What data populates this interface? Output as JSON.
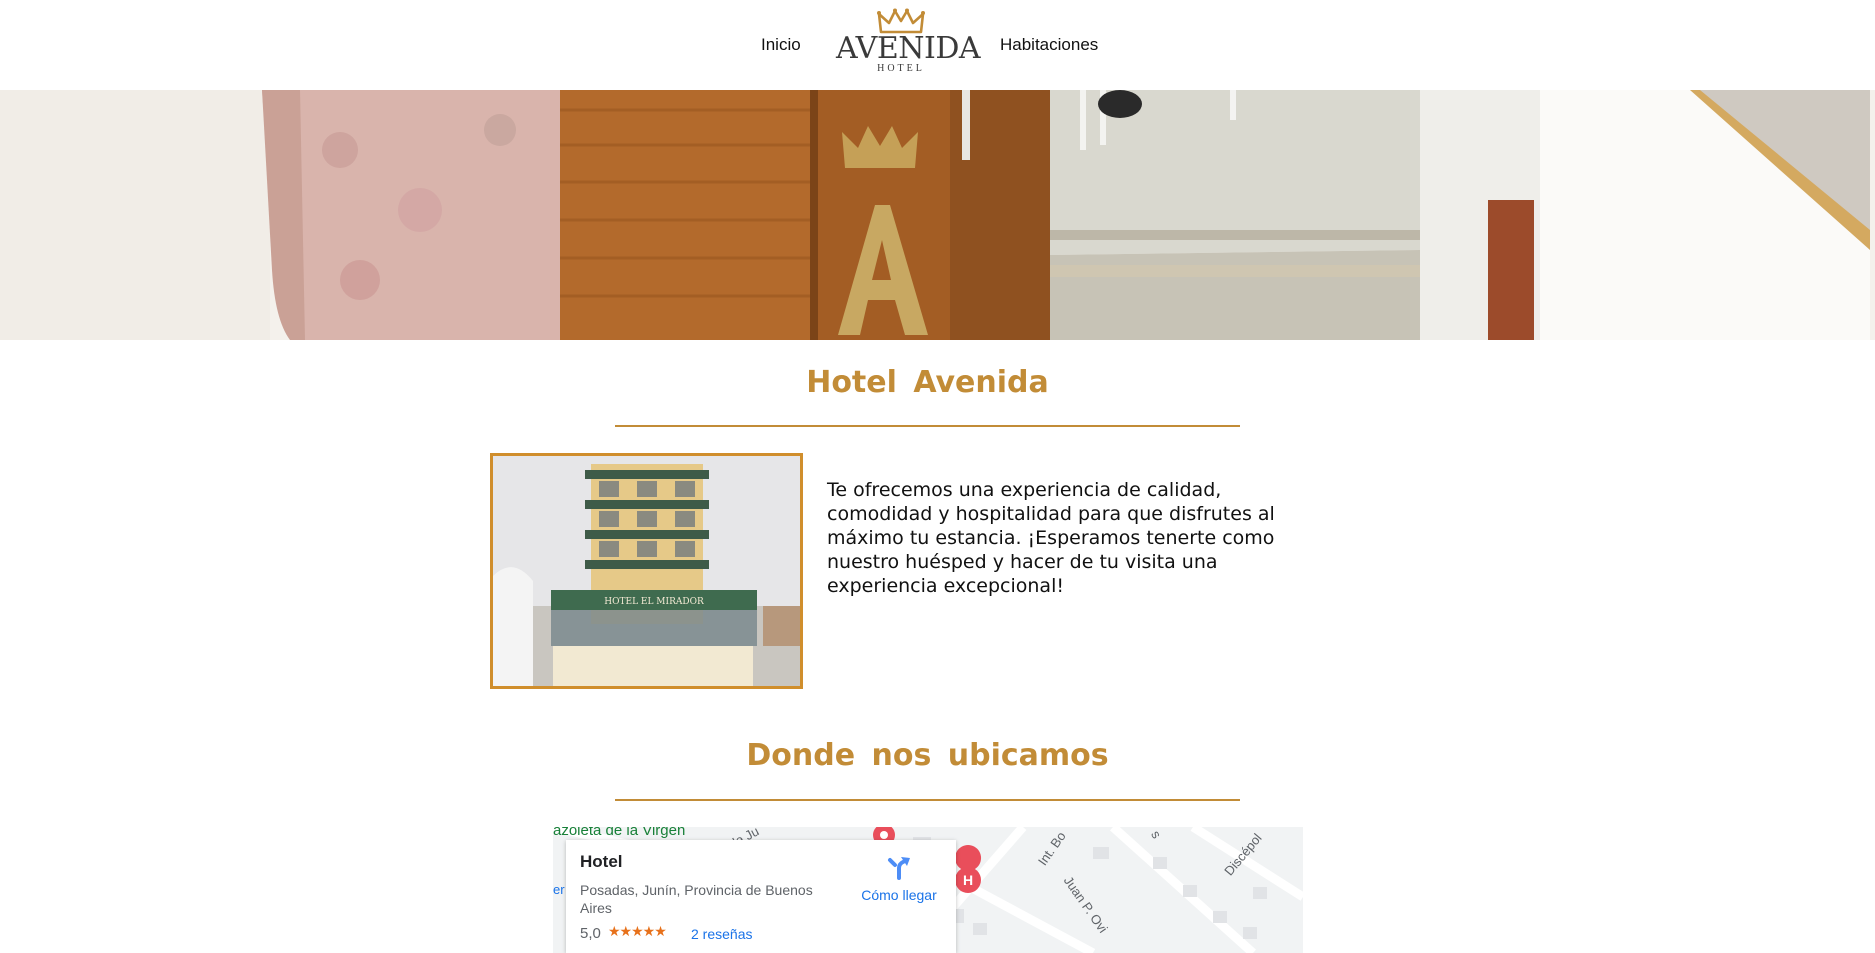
{
  "header": {
    "nav": [
      {
        "label": "Inicio"
      },
      {
        "label": "Habitaciones"
      }
    ],
    "logo": {
      "word": "AVENIDA",
      "sub": "HOTEL",
      "icon": "crown-icon"
    }
  },
  "about": {
    "title": "Hotel Avenida",
    "text": "Te ofrecemos una experiencia de calidad, comodidad y hospitalidad para que disfrutes al máximo tu estancia. ¡Esperamos tenerte como nuestro huésped y hacer de tu visita una experiencia excepcional!"
  },
  "location": {
    "title": "Donde nos ubicamos",
    "map": {
      "place_name": "Hotel",
      "address": "Posadas, Junín, Provincia de Buenos Aires",
      "rating": "5,0",
      "stars": "★★★★★",
      "reviews": "2 reseñas",
      "directions": "Cómo llegar",
      "labels": {
        "poi": "azoleta de la Virgen",
        "poi_left": "er",
        "street1": "Int. Bo",
        "street2": "Juan P. Ovi",
        "street3": "Discépol",
        "street4": "de Ju",
        "street5": "s"
      }
    }
  },
  "colors": {
    "accent": "#c28c37",
    "photo_border": "#d08e2c",
    "link": "#1a73e8",
    "star": "#e7711b"
  }
}
